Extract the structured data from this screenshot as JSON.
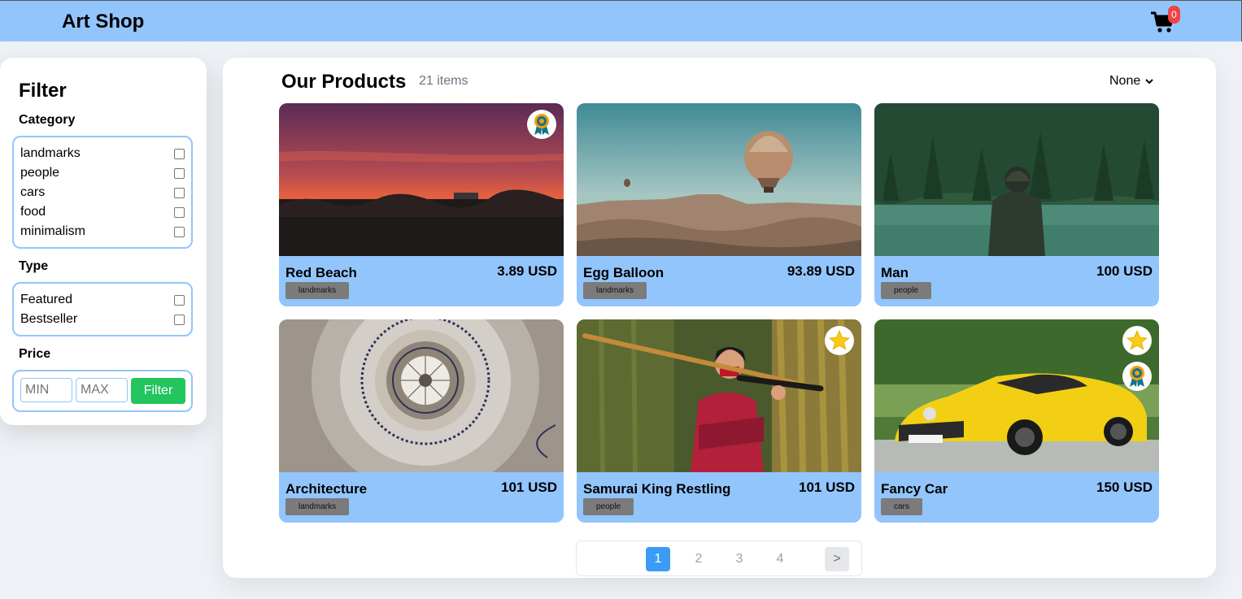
{
  "header": {
    "brand": "Art Shop",
    "cart_count": "0"
  },
  "filter": {
    "title": "Filter",
    "category_title": "Category",
    "categories": [
      {
        "label": "landmarks",
        "checked": false
      },
      {
        "label": "people",
        "checked": false
      },
      {
        "label": "cars",
        "checked": false
      },
      {
        "label": "food",
        "checked": false
      },
      {
        "label": "minimalism",
        "checked": false
      }
    ],
    "type_title": "Type",
    "types": [
      {
        "label": "Featured",
        "checked": false
      },
      {
        "label": "Bestseller",
        "checked": false
      }
    ],
    "price_title": "Price",
    "min_placeholder": "MIN",
    "max_placeholder": "MAX",
    "filter_button": "Filter"
  },
  "products": {
    "title": "Our Products",
    "count": "21 items",
    "sort_selected": "None",
    "items": [
      {
        "name": "Red Beach",
        "price": "3.89 USD",
        "tag": "landmarks",
        "badges": [
          "award-icon"
        ]
      },
      {
        "name": "Egg Balloon",
        "price": "93.89 USD",
        "tag": "landmarks",
        "badges": []
      },
      {
        "name": "Man",
        "price": "100 USD",
        "tag": "people",
        "badges": []
      },
      {
        "name": "Architecture",
        "price": "101 USD",
        "tag": "landmarks",
        "badges": []
      },
      {
        "name": "Samurai King Restling",
        "price": "101 USD",
        "tag": "people",
        "badges": [
          "star-icon"
        ]
      },
      {
        "name": "Fancy Car",
        "price": "150 USD",
        "tag": "cars",
        "badges": [
          "star-icon",
          "award-icon"
        ]
      }
    ]
  },
  "pagination": {
    "pages": [
      "1",
      "2",
      "3",
      "4"
    ],
    "current": "1",
    "next": ">"
  },
  "colors": {
    "header": "#93c5fd",
    "accent_green": "#22c55e",
    "badge_red": "#ef4444",
    "page_active": "#3b9cf6"
  }
}
